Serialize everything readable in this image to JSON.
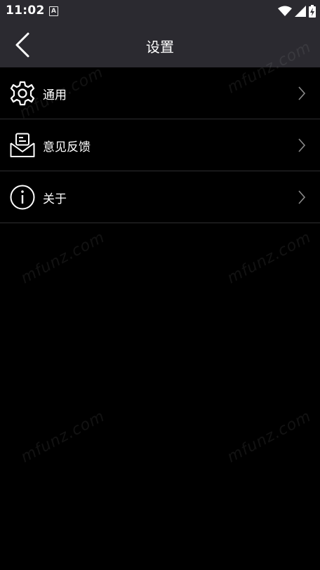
{
  "status_bar": {
    "time": "11:02",
    "notification_icon": "A",
    "icons": [
      "wifi-icon",
      "signal-icon",
      "battery-charging-icon"
    ]
  },
  "app_bar": {
    "title": "设置",
    "back_icon": "chevron-left-icon"
  },
  "settings": {
    "items": [
      {
        "label": "通用",
        "icon": "gear-icon"
      },
      {
        "label": "意见反馈",
        "icon": "feedback-mail-icon"
      },
      {
        "label": "关于",
        "icon": "info-icon"
      }
    ]
  },
  "watermark": "mfunz.com",
  "colors": {
    "bar_background": "#2b2a30",
    "page_background": "#000000",
    "divider": "#2e2e30",
    "chevron": "#8a8a8a"
  }
}
